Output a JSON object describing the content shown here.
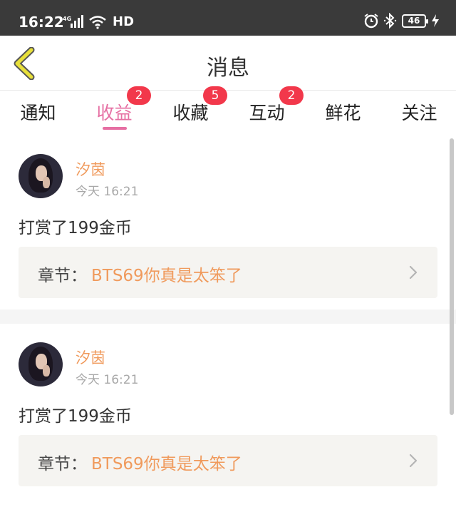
{
  "status_bar": {
    "time": "16:22",
    "network": "4G",
    "hd": "HD",
    "battery": "46",
    "icons": [
      "signal-icon",
      "wifi-icon",
      "alarm-icon",
      "bluetooth-icon",
      "battery-icon",
      "charging-icon"
    ]
  },
  "header": {
    "title": "消息",
    "back_icon": "back-chevron-icon",
    "accent_color": "#e8e03a"
  },
  "tabs": [
    {
      "label": "通知",
      "badge": null,
      "active": false
    },
    {
      "label": "收益",
      "badge": "2",
      "active": true
    },
    {
      "label": "收藏",
      "badge": "5",
      "active": false
    },
    {
      "label": "互动",
      "badge": "2",
      "active": false
    },
    {
      "label": "鲜花",
      "badge": null,
      "active": false
    },
    {
      "label": "关注",
      "badge": null,
      "active": false
    }
  ],
  "colors": {
    "active_tab": "#e66fa3",
    "badge": "#f2384b",
    "name": "#f09a5c",
    "chapter_title": "#f09a5c"
  },
  "messages": [
    {
      "user": "汐茵",
      "time": "今天 16:21",
      "action": "打赏了199金币",
      "chapter_prefix": "章节：",
      "chapter_title": "BTS69你真是太笨了"
    },
    {
      "user": "汐茵",
      "time": "今天 16:21",
      "action": "打赏了199金币",
      "chapter_prefix": "章节：",
      "chapter_title": "BTS69你真是太笨了"
    }
  ]
}
